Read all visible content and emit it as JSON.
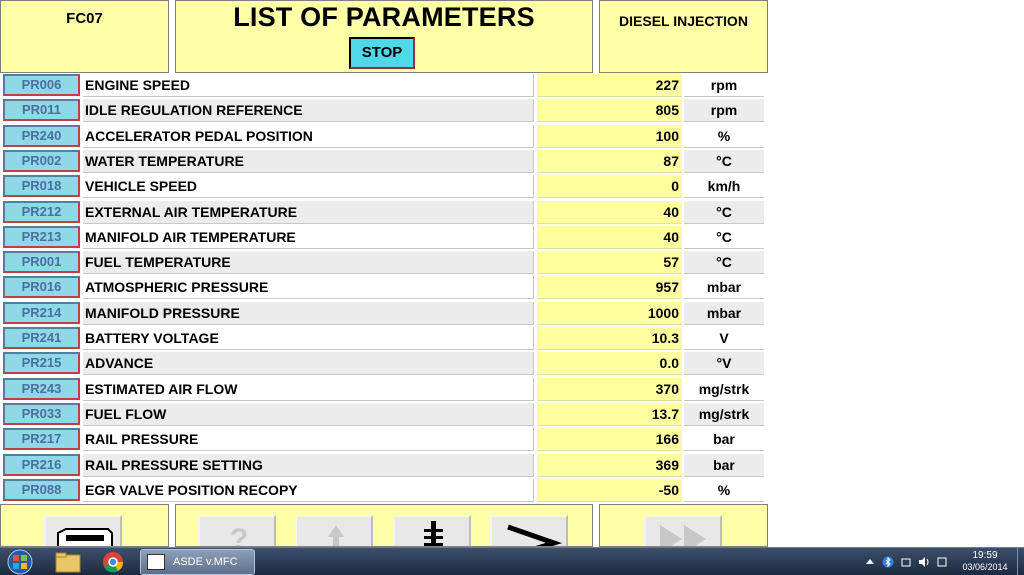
{
  "header": {
    "code": "FC07",
    "title": "LIST OF PARAMETERS",
    "stop_label": "STOP",
    "system": "DIESEL INJECTION"
  },
  "parameters": [
    {
      "code": "PR006",
      "name": "ENGINE SPEED",
      "value": "227",
      "unit": "rpm"
    },
    {
      "code": "PR011",
      "name": "IDLE REGULATION REFERENCE",
      "value": "805",
      "unit": "rpm"
    },
    {
      "code": "PR240",
      "name": "ACCELERATOR PEDAL POSITION",
      "value": "100",
      "unit": "%"
    },
    {
      "code": "PR002",
      "name": "WATER TEMPERATURE",
      "value": "87",
      "unit": "°C"
    },
    {
      "code": "PR018",
      "name": "VEHICLE SPEED",
      "value": "0",
      "unit": "km/h"
    },
    {
      "code": "PR212",
      "name": "EXTERNAL AIR TEMPERATURE",
      "value": "40",
      "unit": "°C"
    },
    {
      "code": "PR213",
      "name": "MANIFOLD AIR TEMPERATURE",
      "value": "40",
      "unit": "°C"
    },
    {
      "code": "PR001",
      "name": "FUEL TEMPERATURE",
      "value": "57",
      "unit": "°C"
    },
    {
      "code": "PR016",
      "name": "ATMOSPHERIC PRESSURE",
      "value": "957",
      "unit": "mbar"
    },
    {
      "code": "PR214",
      "name": "MANIFOLD PRESSURE",
      "value": "1000",
      "unit": "mbar"
    },
    {
      "code": "PR241",
      "name": "BATTERY VOLTAGE",
      "value": "10.3",
      "unit": "V"
    },
    {
      "code": "PR215",
      "name": "ADVANCE",
      "value": "0.0",
      "unit": "°V"
    },
    {
      "code": "PR243",
      "name": "ESTIMATED AIR FLOW",
      "value": "370",
      "unit": "mg/strk"
    },
    {
      "code": "PR033",
      "name": "FUEL FLOW",
      "value": "13.7",
      "unit": "mg/strk"
    },
    {
      "code": "PR217",
      "name": "RAIL PRESSURE",
      "value": "166",
      "unit": "bar"
    },
    {
      "code": "PR216",
      "name": "RAIL PRESSURE SETTING",
      "value": "369",
      "unit": "bar"
    },
    {
      "code": "PR088",
      "name": "EGR VALVE POSITION RECOPY",
      "value": "-50",
      "unit": "%"
    }
  ],
  "toolbar": {
    "buttons": [
      {
        "icon": "printer-icon"
      },
      {
        "icon": "help-icon"
      },
      {
        "icon": "up-arrow-icon"
      },
      {
        "icon": "diagnostic-connector-icon"
      },
      {
        "icon": "next-chevron-icon"
      },
      {
        "icon": "fast-forward-icon"
      }
    ]
  },
  "taskbar": {
    "task_label": "ASDE v.MFC",
    "time": "19:59",
    "date": "03/06/2014"
  }
}
